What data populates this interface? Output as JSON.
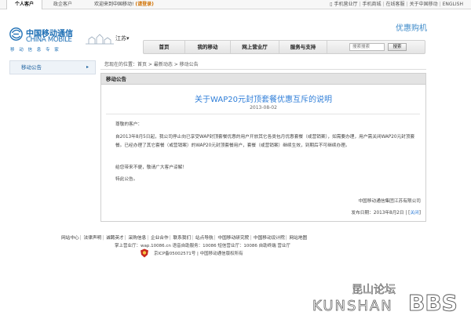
{
  "topbar": {
    "tab_personal": "个人客户",
    "tab_enterprise": "政企客户",
    "welcome": "欢迎来到中国移动!",
    "login": "(请登录)",
    "links": [
      "手机营业厅",
      "手机商城",
      "在线客服",
      "关于中国移动",
      "ENGLISH"
    ]
  },
  "logo": {
    "cn": "中国移动通信",
    "en": "CHINA MOBILE",
    "slogan": "移 动 信 息 专 家"
  },
  "province": "江苏▾",
  "promo": {
    "a": "优惠",
    "b": "购机"
  },
  "nav": {
    "items": [
      "首页",
      "我的移动",
      "网上营业厅",
      "服务与支持"
    ],
    "search_placeholder": "搜索搜索",
    "search_button": "搜索"
  },
  "sidebar": {
    "label": "移动公告",
    "arrow": "▸"
  },
  "breadcrumb": "您现在的位置：首页 > 最新动态 > 移动公告",
  "panel": {
    "header": "移动公告",
    "title": "关于WAP20元封顶套餐优惠互斥的说明",
    "date": "2013-08-02",
    "greeting": "尊敬的客户：",
    "main": "自2013年8月5日起，我公司停止向已享受WAP封顶套餐优惠的用户开放其它各类包月优惠套餐（或营销案），如需要办理，用户需关闭WAP20元封顶套餐。已经办理了其它套餐（或营销案）的WAP20元封顶套餐用户，套餐（或营销案）继续生效，到期后不可继续办理。",
    "sorry": "给您带来不便，敬请广大客户谅解！",
    "notice": "特此公告。",
    "org": "中国移动通信集团江苏有限公司",
    "pubdate_label": "发布日期：2013年8月2日",
    "close": "关闭"
  },
  "footer": {
    "links": [
      "网站中心",
      "法律声明",
      "诚聘英才",
      "采购信息",
      "企业合作",
      "联系我们",
      "站点导航",
      "中国移动研究院",
      "中国移动设计院",
      "网站地图"
    ],
    "info": "掌上营业厅：wap.10086.cn 语音自助服务：10086 短信营业厅：10086 自助终端 营业厅",
    "icp": "京ICP备05002571号 | 中国移动通信版权所有"
  },
  "watermark": {
    "cn": "昆山论坛",
    "en": "KUNSHAN",
    "bbs": "BBS"
  },
  "colors": {
    "brand": "#1a6db4",
    "link": "#2f7ed8",
    "login": "#d07000"
  }
}
